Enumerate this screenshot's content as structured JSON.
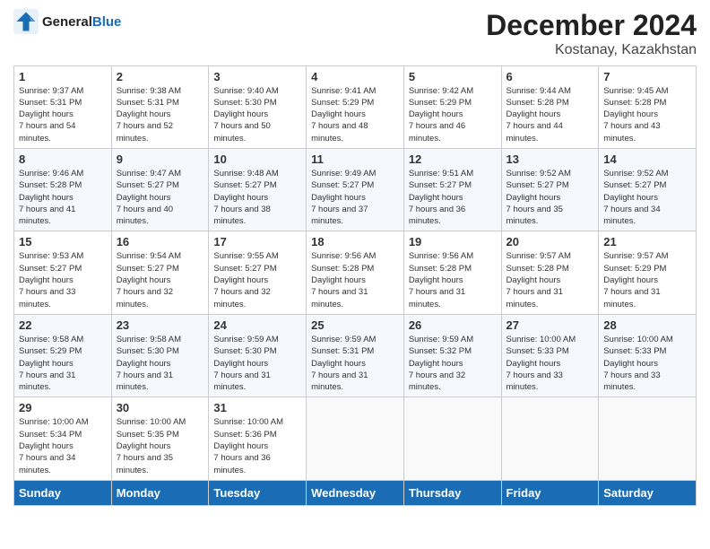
{
  "logo": {
    "line1": "General",
    "line2": "Blue"
  },
  "title": "December 2024",
  "location": "Kostanay, Kazakhstan",
  "days_header": [
    "Sunday",
    "Monday",
    "Tuesday",
    "Wednesday",
    "Thursday",
    "Friday",
    "Saturday"
  ],
  "weeks": [
    [
      {
        "day": "1",
        "sunrise": "9:37 AM",
        "sunset": "5:31 PM",
        "daylight": "7 hours and 54 minutes."
      },
      {
        "day": "2",
        "sunrise": "9:38 AM",
        "sunset": "5:31 PM",
        "daylight": "7 hours and 52 minutes."
      },
      {
        "day": "3",
        "sunrise": "9:40 AM",
        "sunset": "5:30 PM",
        "daylight": "7 hours and 50 minutes."
      },
      {
        "day": "4",
        "sunrise": "9:41 AM",
        "sunset": "5:29 PM",
        "daylight": "7 hours and 48 minutes."
      },
      {
        "day": "5",
        "sunrise": "9:42 AM",
        "sunset": "5:29 PM",
        "daylight": "7 hours and 46 minutes."
      },
      {
        "day": "6",
        "sunrise": "9:44 AM",
        "sunset": "5:28 PM",
        "daylight": "7 hours and 44 minutes."
      },
      {
        "day": "7",
        "sunrise": "9:45 AM",
        "sunset": "5:28 PM",
        "daylight": "7 hours and 43 minutes."
      }
    ],
    [
      {
        "day": "8",
        "sunrise": "9:46 AM",
        "sunset": "5:28 PM",
        "daylight": "7 hours and 41 minutes."
      },
      {
        "day": "9",
        "sunrise": "9:47 AM",
        "sunset": "5:27 PM",
        "daylight": "7 hours and 40 minutes."
      },
      {
        "day": "10",
        "sunrise": "9:48 AM",
        "sunset": "5:27 PM",
        "daylight": "7 hours and 38 minutes."
      },
      {
        "day": "11",
        "sunrise": "9:49 AM",
        "sunset": "5:27 PM",
        "daylight": "7 hours and 37 minutes."
      },
      {
        "day": "12",
        "sunrise": "9:51 AM",
        "sunset": "5:27 PM",
        "daylight": "7 hours and 36 minutes."
      },
      {
        "day": "13",
        "sunrise": "9:52 AM",
        "sunset": "5:27 PM",
        "daylight": "7 hours and 35 minutes."
      },
      {
        "day": "14",
        "sunrise": "9:52 AM",
        "sunset": "5:27 PM",
        "daylight": "7 hours and 34 minutes."
      }
    ],
    [
      {
        "day": "15",
        "sunrise": "9:53 AM",
        "sunset": "5:27 PM",
        "daylight": "7 hours and 33 minutes."
      },
      {
        "day": "16",
        "sunrise": "9:54 AM",
        "sunset": "5:27 PM",
        "daylight": "7 hours and 32 minutes."
      },
      {
        "day": "17",
        "sunrise": "9:55 AM",
        "sunset": "5:27 PM",
        "daylight": "7 hours and 32 minutes."
      },
      {
        "day": "18",
        "sunrise": "9:56 AM",
        "sunset": "5:28 PM",
        "daylight": "7 hours and 31 minutes."
      },
      {
        "day": "19",
        "sunrise": "9:56 AM",
        "sunset": "5:28 PM",
        "daylight": "7 hours and 31 minutes."
      },
      {
        "day": "20",
        "sunrise": "9:57 AM",
        "sunset": "5:28 PM",
        "daylight": "7 hours and 31 minutes."
      },
      {
        "day": "21",
        "sunrise": "9:57 AM",
        "sunset": "5:29 PM",
        "daylight": "7 hours and 31 minutes."
      }
    ],
    [
      {
        "day": "22",
        "sunrise": "9:58 AM",
        "sunset": "5:29 PM",
        "daylight": "7 hours and 31 minutes."
      },
      {
        "day": "23",
        "sunrise": "9:58 AM",
        "sunset": "5:30 PM",
        "daylight": "7 hours and 31 minutes."
      },
      {
        "day": "24",
        "sunrise": "9:59 AM",
        "sunset": "5:30 PM",
        "daylight": "7 hours and 31 minutes."
      },
      {
        "day": "25",
        "sunrise": "9:59 AM",
        "sunset": "5:31 PM",
        "daylight": "7 hours and 31 minutes."
      },
      {
        "day": "26",
        "sunrise": "9:59 AM",
        "sunset": "5:32 PM",
        "daylight": "7 hours and 32 minutes."
      },
      {
        "day": "27",
        "sunrise": "10:00 AM",
        "sunset": "5:33 PM",
        "daylight": "7 hours and 33 minutes."
      },
      {
        "day": "28",
        "sunrise": "10:00 AM",
        "sunset": "5:33 PM",
        "daylight": "7 hours and 33 minutes."
      }
    ],
    [
      {
        "day": "29",
        "sunrise": "10:00 AM",
        "sunset": "5:34 PM",
        "daylight": "7 hours and 34 minutes."
      },
      {
        "day": "30",
        "sunrise": "10:00 AM",
        "sunset": "5:35 PM",
        "daylight": "7 hours and 35 minutes."
      },
      {
        "day": "31",
        "sunrise": "10:00 AM",
        "sunset": "5:36 PM",
        "daylight": "7 hours and 36 minutes."
      },
      null,
      null,
      null,
      null
    ]
  ],
  "labels": {
    "sunrise": "Sunrise:",
    "sunset": "Sunset:",
    "daylight": "Daylight hours"
  }
}
